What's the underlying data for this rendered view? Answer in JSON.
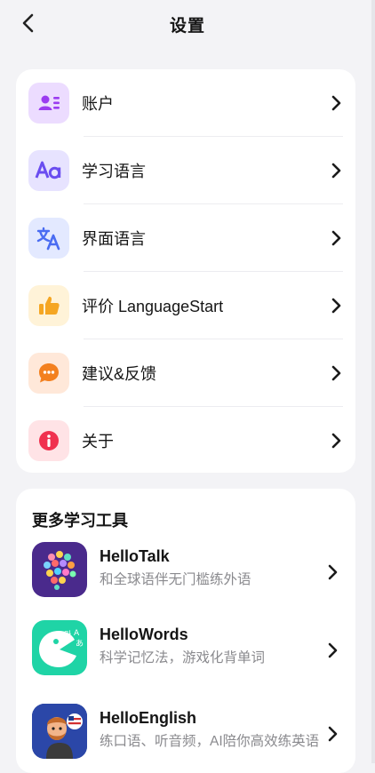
{
  "header": {
    "title": "设置"
  },
  "settings": {
    "items": [
      {
        "label": "账户",
        "icon": "account-icon"
      },
      {
        "label": "学习语言",
        "icon": "aa-icon"
      },
      {
        "label": "界面语言",
        "icon": "translate-icon"
      },
      {
        "label": "评价 LanguageStart",
        "icon": "thumbs-up-icon"
      },
      {
        "label": "建议&反馈",
        "icon": "chat-bubble-icon"
      },
      {
        "label": "关于",
        "icon": "info-icon"
      }
    ]
  },
  "tools": {
    "title": "更多学习工具",
    "apps": [
      {
        "name": "HelloTalk",
        "desc": "和全球语伴无门槛练外语"
      },
      {
        "name": "HelloWords",
        "desc": "科学记忆法，游戏化背单词"
      },
      {
        "name": "HelloEnglish",
        "desc": "练口语、听音频，AI陪你高效练英语"
      }
    ]
  },
  "colors": {
    "account_bg": "#ecdcff",
    "aa_bg": "#e7e3ff",
    "translate_bg": "#e3e9ff",
    "thumbs_bg": "#fff3d8",
    "chat_bg": "#ffe8d9",
    "info_bg": "#ffe3e6"
  }
}
